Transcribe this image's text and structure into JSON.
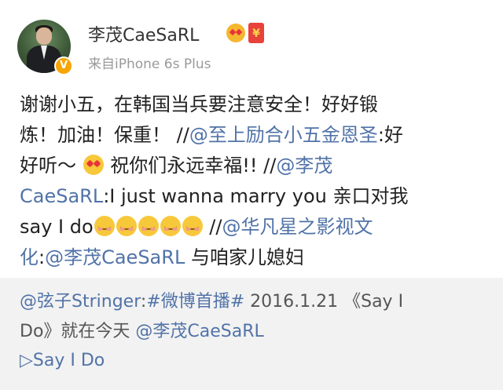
{
  "user": {
    "name": "李茂CaeSaRL",
    "source": "来自iPhone 6s Plus",
    "verified_mark": "V"
  },
  "post": {
    "l1": "谢谢小五，在韩国当兵要注意安全！好好锻",
    "l2_a": "炼！加油！保重！ //",
    "l2_b": "@至上励合小五金恩圣",
    "l2_c": ":好",
    "l3_a": "好听～",
    "l3_b": "祝你们永远幸福!! //",
    "l3_c": "@李茂",
    "l4_a": "CaeSaRL",
    "l4_b": ":I just wanna marry you  亲口对我",
    "l5_a": "say I do",
    "l5_b": " //",
    "l5_c": "@华凡星之影视文",
    "l6_a": "化",
    "l6_b": ":",
    "l6_c": "@李茂CaeSaRL",
    "l6_d": " 与咱家儿媳妇"
  },
  "repost": {
    "l1_a": "@弦子Stringer",
    "l1_b": ":",
    "l1_c": "#微博首播#",
    "l1_d": " 2016.1.21 《Say I",
    "l2_a": "Do》就在今天 ",
    "l2_b": "@李茂CaeSaRL",
    "video_link": "▷Say I Do"
  },
  "colors": {
    "link": "#5173a8",
    "repost_bg": "#f2f2f2",
    "verified": "#f7a500"
  },
  "icons": [
    "smiling-face-heart-eyes-icon",
    "red-envelope-icon",
    "smile-blush-icon"
  ]
}
